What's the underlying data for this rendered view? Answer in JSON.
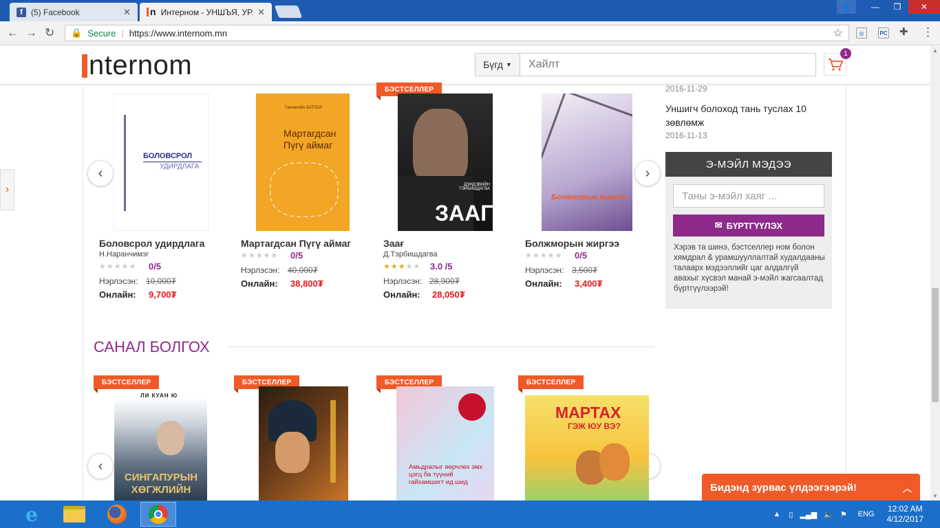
{
  "browser": {
    "tabs": [
      {
        "label": "(5) Facebook"
      },
      {
        "label": "Интерном - УНШЪЯ, УРА"
      }
    ],
    "secure_label": "Secure",
    "url": "https://www.internom.mn"
  },
  "site": {
    "logo_text": "nternom",
    "search": {
      "category_label": "Бүгд",
      "placeholder": "Хайлт"
    },
    "cart_count": "1"
  },
  "carousel1": {
    "books": [
      {
        "title": "Боловсрол удирдлага",
        "author": "Н.Наранчимэг",
        "rating": "0/5",
        "stars": 0,
        "old_label": "Нэрлэсэн:",
        "old_price": "10,000₮",
        "online_label": "Онлайн:",
        "new_price": "9,700₮",
        "cover_title": "БОЛОВСРОЛ",
        "cover_sub": "УДИРДЛАГА"
      },
      {
        "title": "Мартагдсан Пүгү аймаг",
        "author": "",
        "rating": "0/5",
        "stars": 0,
        "old_label": "Нэрлэсэн:",
        "old_price": "40,000₮",
        "online_label": "Онлайн:",
        "new_price": "38,800₮",
        "cover_title": "Мартагдсан Пүгү аймаг",
        "cover_author": "Ганчөлийн БАТЗОЛ"
      },
      {
        "title": "Заағ",
        "author": "Д.Тэрбишдагва",
        "rating": "3.0 /5",
        "stars": 3,
        "old_label": "Нэрлэсэн:",
        "old_price": "28,900₮",
        "online_label": "Онлайн:",
        "new_price": "28,050₮",
        "badge": "БЭСТСЕЛЛЕР",
        "cover_title": "ЗААГ",
        "cover_author": "ДЭНДЭВИЙН ТЭРБИШДАГВА"
      },
      {
        "title": "Болжморын жиргээ",
        "author": "",
        "rating": "0/5",
        "stars": 0,
        "old_label": "Нэрлэсэн:",
        "old_price": "3,500₮",
        "online_label": "Онлайн:",
        "new_price": "3,400₮",
        "cover_title": "Болжморын жиргээ"
      }
    ]
  },
  "section2": {
    "title": "САНАЛ БОЛГОХ",
    "books": [
      {
        "badge": "БЭСТСЕЛЛЕР",
        "cover_top": "ЛИ КУАН Ю",
        "cover_title": "СИНГАПУРЫН ХӨГЖЛИЙН"
      },
      {
        "badge": "БЭСТСЕЛЛЕР"
      },
      {
        "badge": "БЭСТСЕЛЛЕР",
        "cover_title": "Амьдралыг өөрчлөх эмх цэгц ба түүний гайхамшигт ид шид"
      },
      {
        "badge": "БЭСТСЕЛЛЕР",
        "cover_title": "МАРТАХ",
        "cover_sub": "ГЭЖ ЮУ ВЭ?"
      }
    ]
  },
  "sidebar": {
    "news": [
      {
        "date": "2016-11-29"
      },
      {
        "text": "Уншигч болоход тань туслах 10 зөвлөмж",
        "date": "2016-11-13"
      }
    ],
    "email": {
      "header": "Э-МЭЙЛ МЭДЭЭ",
      "placeholder": "Таны э-мэйл хаяг ...",
      "button": "БҮРТГҮҮЛЭХ",
      "description": "Хэрэв та шинэ, бэстселлер ном болон хямдрал & урамшууллалтай худалдааны талаарх мэдээллийг цаг алдалгүй авахыг хүсвэл манай э-мэйл жагсаалтад бүртгүүлээрэй!"
    }
  },
  "chat": {
    "label": "Бидэнд зурвас үлдээгээрэй!"
  },
  "taskbar": {
    "language": "ENG",
    "time": "12:02 AM",
    "date": "4/12/2017"
  },
  "colors": {
    "accent": "#f05a28",
    "purple": "#8e2a8c",
    "price_red": "#e21b1b",
    "taskbar": "#1b6fc9"
  }
}
